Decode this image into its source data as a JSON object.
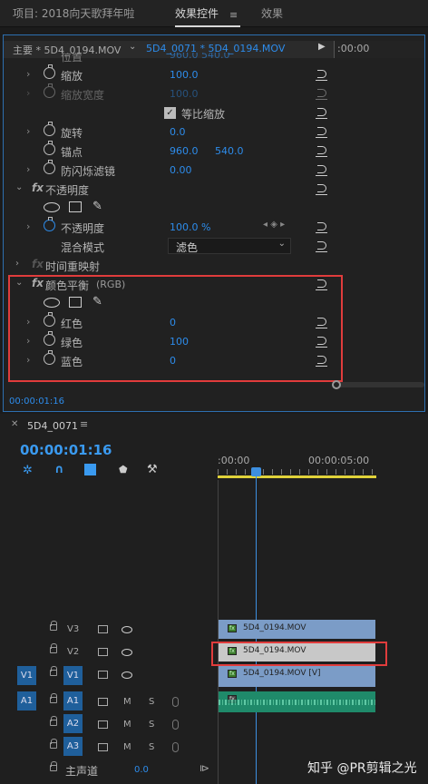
{
  "tabs": {
    "project": "项目: 2018向天歌拜年啦",
    "effect_controls": "效果控件",
    "effects": "效果"
  },
  "source_bar": {
    "master": "主要 * 5D4_0194.MOV",
    "sequence": "5D4_0071 * 5D4_0194.MOV",
    "timecode": ":00:00"
  },
  "motion": {
    "partial_label": "位置",
    "partial_value": "960.0 540.0",
    "scale": {
      "label": "缩放",
      "value": "100.0"
    },
    "scale_width": {
      "label": "缩放宽度",
      "value": "100.0"
    },
    "uniform": {
      "label": "等比缩放",
      "checked": true
    },
    "rotation": {
      "label": "旋转",
      "value": "0.0"
    },
    "anchor": {
      "label": "锚点",
      "x": "960.0",
      "y": "540.0"
    },
    "flicker": {
      "label": "防闪烁滤镜",
      "value": "0.00"
    }
  },
  "opacity": {
    "title": "不透明度",
    "label": "不透明度",
    "value": "100.0 %",
    "blend_label": "混合模式",
    "blend_value": "滤色"
  },
  "time_remap": {
    "title": "时间重映射"
  },
  "color_balance": {
    "title": "颜色平衡",
    "suffix": "(RGB)",
    "red": {
      "label": "红色",
      "value": "0"
    },
    "green": {
      "label": "绿色",
      "value": "100"
    },
    "blue": {
      "label": "蓝色",
      "value": "0"
    }
  },
  "ec_timecode": "00:00:01:16",
  "timeline": {
    "seq_name": "5D4_0071",
    "timecode": "00:00:01:16",
    "ruler_start": ":00:00",
    "ruler_mid": "00:00:05:00",
    "tracks": {
      "v3": "V3",
      "v2": "V2",
      "v1": "V1",
      "a1": "A1",
      "a2": "A2",
      "a3": "A3",
      "src_v": "V1",
      "src_a": "A1",
      "m": "M",
      "s": "S"
    },
    "master": {
      "label": "主声道",
      "value": "0.0"
    },
    "clips": {
      "v3": "5D4_0194.MOV",
      "v2": "5D4_0194.MOV",
      "v1": "5D4_0194.MOV [V]"
    }
  },
  "watermark": "知乎 @PR剪辑之光",
  "colors": {
    "accent": "#2d8ceb",
    "highlight_box": "#e03c3c",
    "clip_video": "#7b9cc7",
    "clip_audio": "#1f8a6a",
    "playhead": "#3d8fe0"
  }
}
